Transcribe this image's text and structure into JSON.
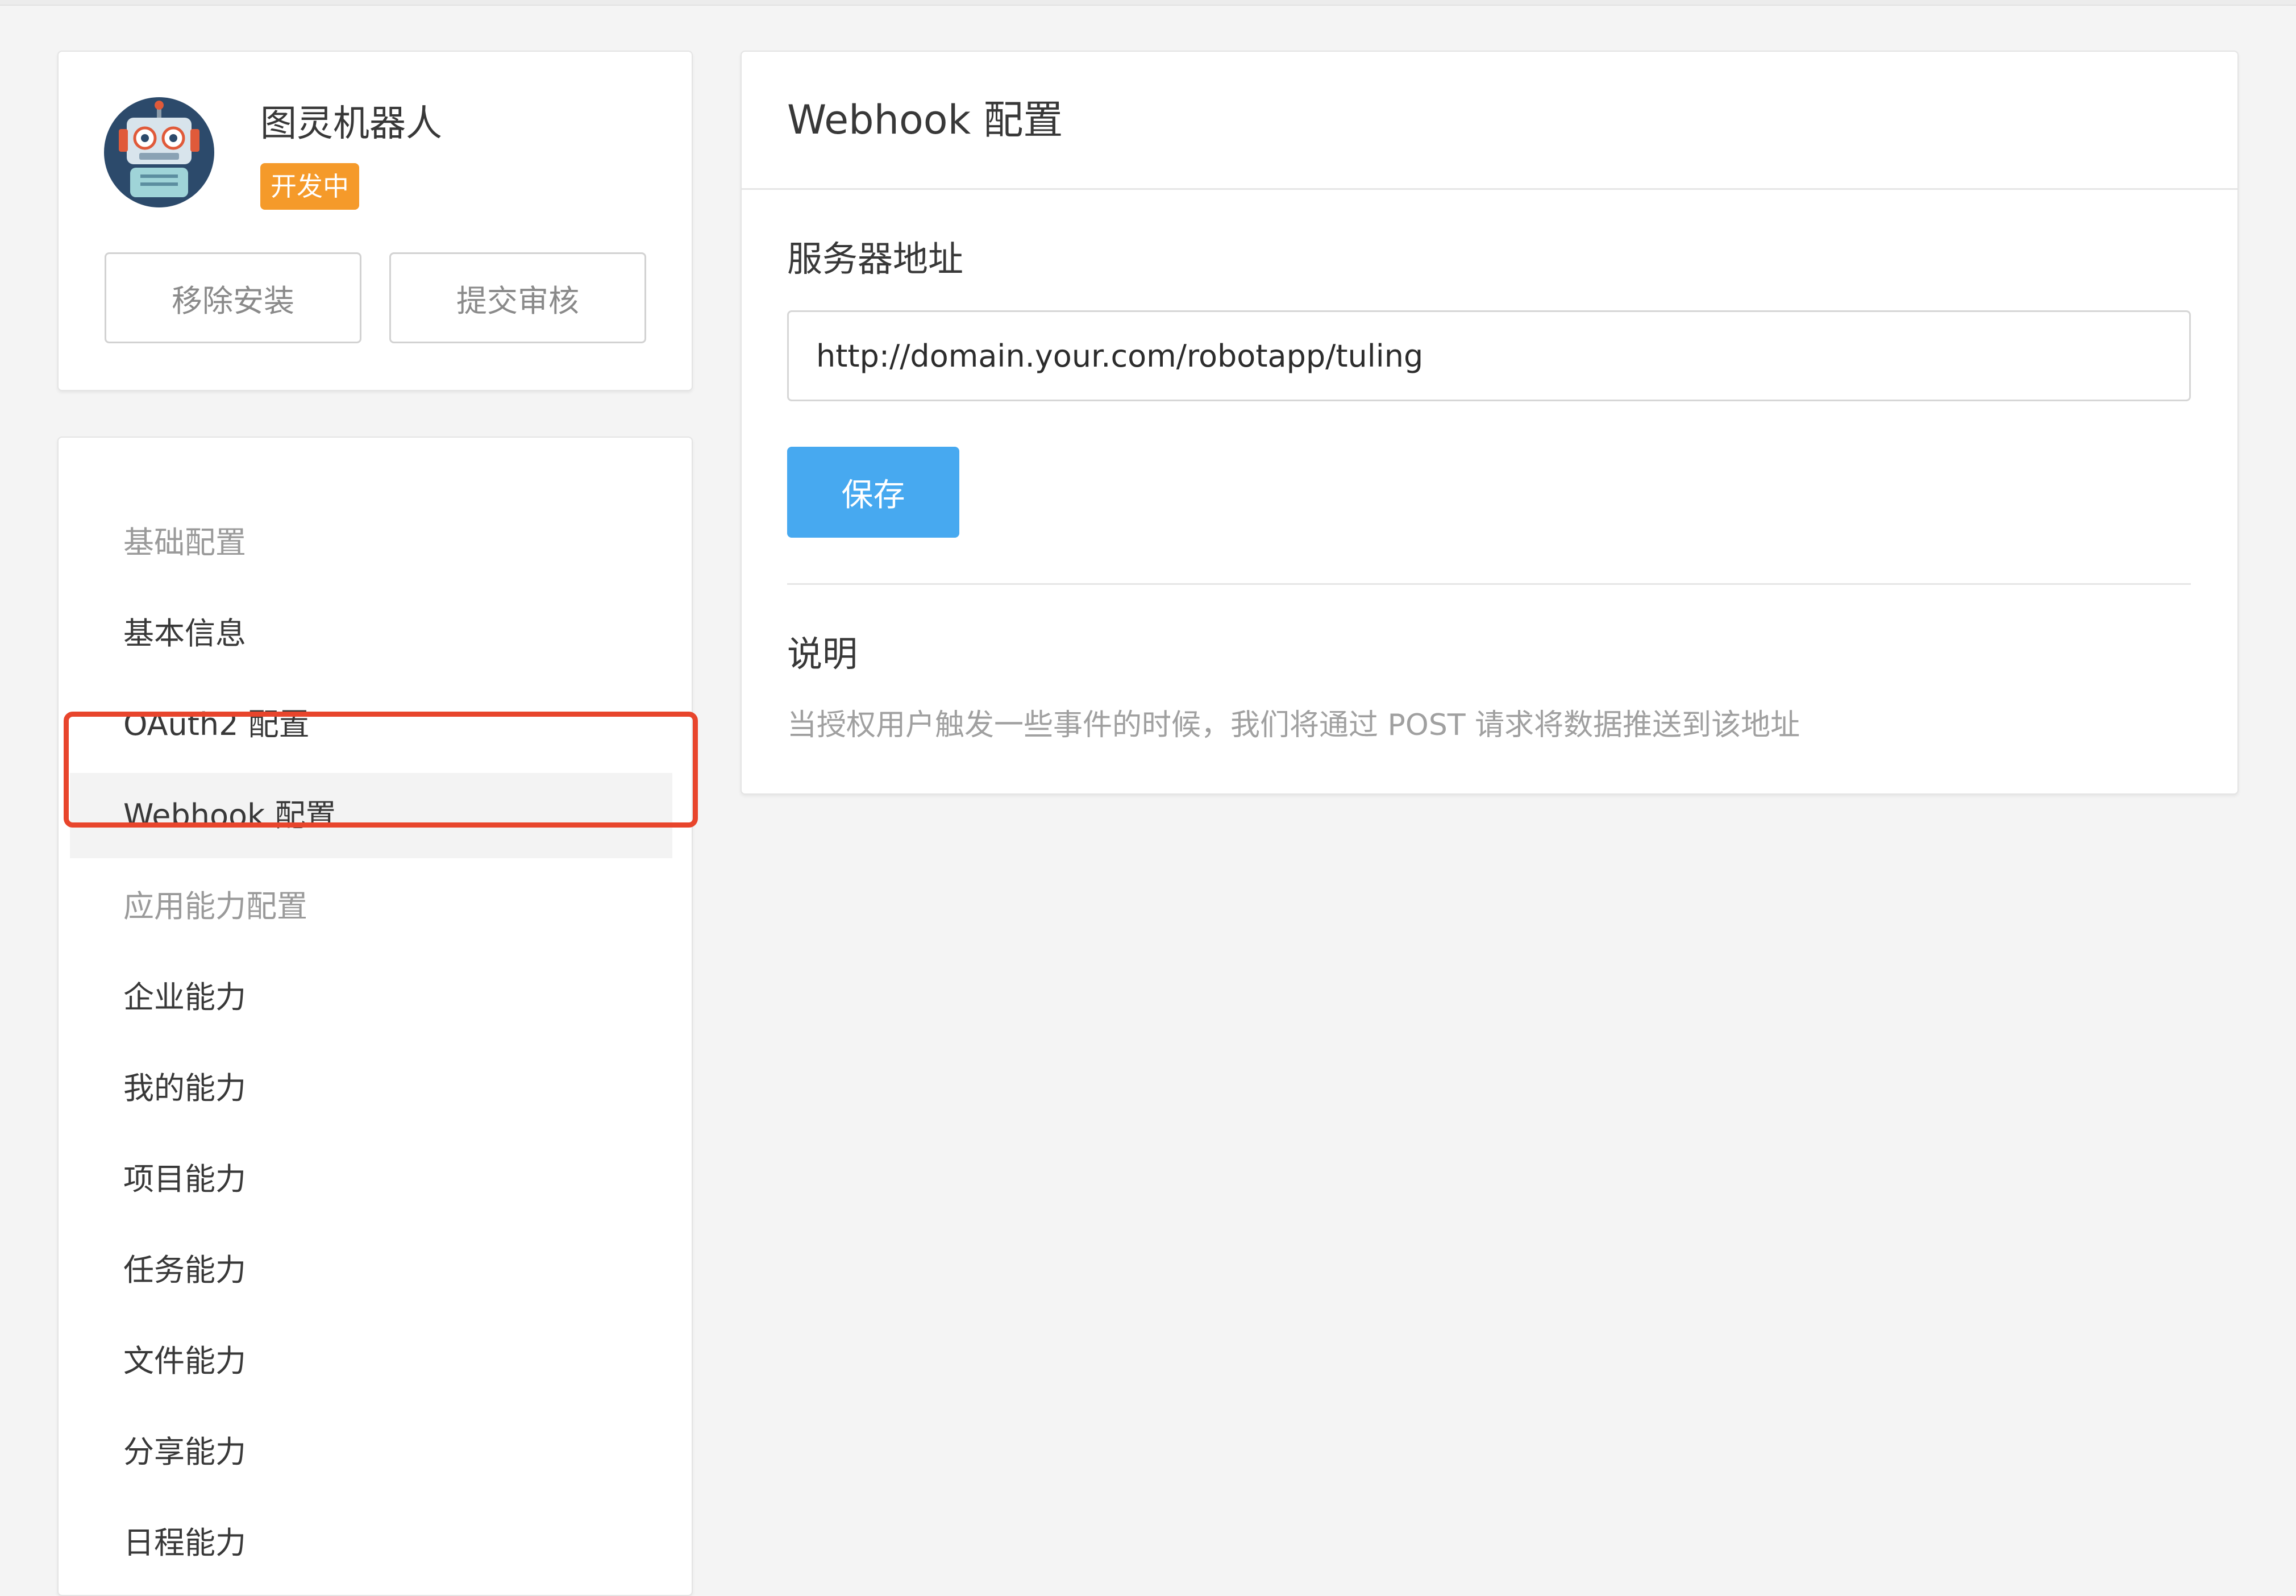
{
  "app": {
    "name": "图灵机器人",
    "status": "开发中",
    "remove_label": "移除安装",
    "submit_label": "提交审核",
    "avatar_icon": "robot-avatar-icon"
  },
  "sidebar": {
    "items": [
      {
        "label": "基础配置",
        "type": "section"
      },
      {
        "label": "基本信息",
        "type": "link"
      },
      {
        "label": "OAuth2 配置",
        "type": "link"
      },
      {
        "label": "Webhook 配置",
        "type": "link",
        "active": true
      },
      {
        "label": "应用能力配置",
        "type": "section"
      },
      {
        "label": "企业能力",
        "type": "link"
      },
      {
        "label": "我的能力",
        "type": "link"
      },
      {
        "label": "项目能力",
        "type": "link"
      },
      {
        "label": "任务能力",
        "type": "link"
      },
      {
        "label": "文件能力",
        "type": "link"
      },
      {
        "label": "分享能力",
        "type": "link"
      },
      {
        "label": "日程能力",
        "type": "link"
      }
    ]
  },
  "main": {
    "title": "Webhook 配置",
    "server_label": "服务器地址",
    "server_url": "http://domain.your.com/robotapp/tuling",
    "save_label": "保存",
    "note_title": "说明",
    "note_text": "当授权用户触发一些事件的时候，我们将通过 POST 请求将数据推送到该地址"
  },
  "colors": {
    "background": "#f4f4f4",
    "badge": "#f59a2a",
    "primary_button": "#47a9f0",
    "highlight_border": "#e8452c",
    "section_text": "#9a9a9a"
  }
}
